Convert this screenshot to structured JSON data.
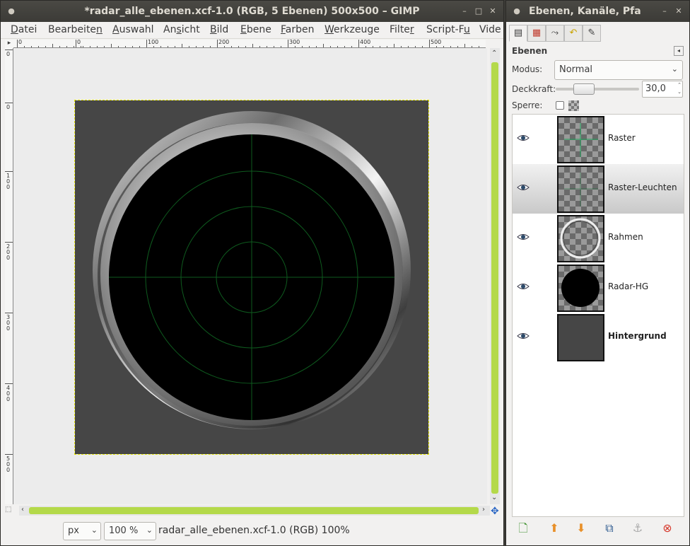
{
  "main_window": {
    "title": "*radar_alle_ebenen.xcf-1.0 (RGB, 5 Ebenen) 500x500 – GIMP",
    "controls": [
      "–",
      "□",
      "✕"
    ],
    "menu": [
      {
        "label": "Datei",
        "key": "D"
      },
      {
        "label": "Bearbeiten",
        "key": "n"
      },
      {
        "label": "Auswahl",
        "key": "A"
      },
      {
        "label": "Ansicht",
        "key": "s"
      },
      {
        "label": "Bild",
        "key": "B"
      },
      {
        "label": "Ebene",
        "key": "E"
      },
      {
        "label": "Farben",
        "key": "F"
      },
      {
        "label": "Werkzeuge",
        "key": "W"
      },
      {
        "label": "Filter",
        "key": "r"
      },
      {
        "label": "Script-Fu",
        "key": "u"
      },
      {
        "label": "Vide",
        "key": ""
      }
    ],
    "hruler_labels": [
      "0",
      "0",
      "100",
      "200",
      "300",
      "400",
      "500"
    ],
    "vruler_labels": [
      "0",
      "0",
      "100",
      "200",
      "300",
      "400",
      "500"
    ],
    "status": {
      "unit": "px",
      "zoom": "100 %",
      "text": "radar_alle_ebenen.xcf-1.0 (RGB) 100%"
    }
  },
  "dock_window": {
    "title": "Ebenen, Kanäle, Pfa",
    "controls": [
      "–",
      "✕"
    ],
    "panel_title": "Ebenen",
    "mode_label": "Modus:",
    "mode_value": "Normal",
    "opacity_label": "Deckkraft:",
    "opacity_value": "30,0",
    "opacity_fraction": 0.3,
    "lock_label": "Sperre:",
    "layers": [
      {
        "name": "Raster",
        "bold": false,
        "selected": false
      },
      {
        "name": "Raster-Leuchten",
        "bold": false,
        "selected": true
      },
      {
        "name": "Rahmen",
        "bold": false,
        "selected": false
      },
      {
        "name": "Radar-HG",
        "bold": false,
        "selected": false
      },
      {
        "name": "Hintergrund",
        "bold": true,
        "selected": false
      }
    ]
  },
  "colors": {
    "accent_scrollbar": "#b4d94a",
    "titlebar": "#3c3b37",
    "image_bg": "#464646",
    "radar_grid": "#0e5a1e"
  }
}
